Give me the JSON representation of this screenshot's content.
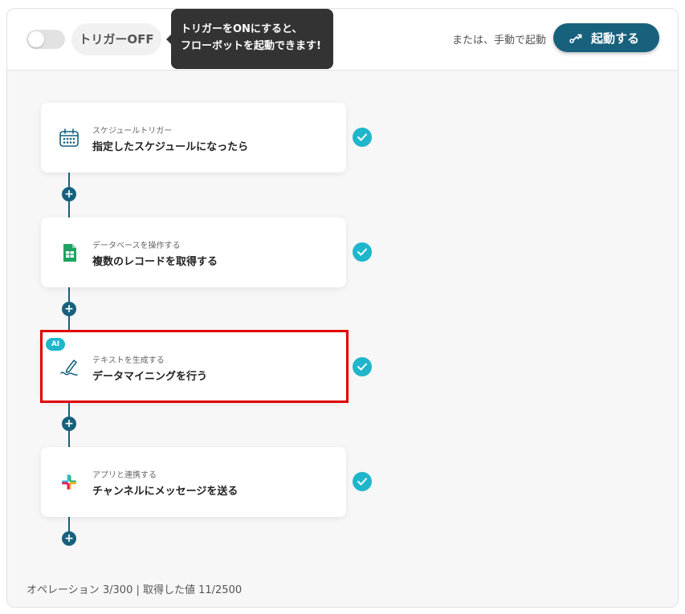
{
  "header": {
    "toggle_state": "off",
    "trigger_label": "トリガーOFF",
    "tooltip_line1": "トリガーをONにすると、",
    "tooltip_line2": "フローボットを起動できます!",
    "manual_text": "または、手動で起動",
    "start_label": "起動する",
    "start_icon": "route-icon",
    "accent_color": "#17617d"
  },
  "steps": [
    {
      "subtitle": "スケジュールトリガー",
      "title": "指定したスケジュールになったら",
      "icon": "calendar-icon",
      "status": "complete"
    },
    {
      "subtitle": "データベースを操作する",
      "title": "複数のレコードを取得する",
      "icon": "google-sheets-icon",
      "status": "complete"
    },
    {
      "subtitle": "テキストを生成する",
      "title": "データマイニングを行う",
      "icon": "pen-icon",
      "badge": "AI",
      "status": "complete",
      "highlighted": true
    },
    {
      "subtitle": "アプリと連携する",
      "title": "チャンネルにメッセージを送る",
      "icon": "slack-icon",
      "status": "complete"
    }
  ],
  "add_step_symbol": "+",
  "footer": {
    "status_text": "オペレーション 3/300 | 取得した値 11/2500"
  },
  "colors": {
    "check": "#1fb6cc",
    "highlight": "#e00000"
  }
}
